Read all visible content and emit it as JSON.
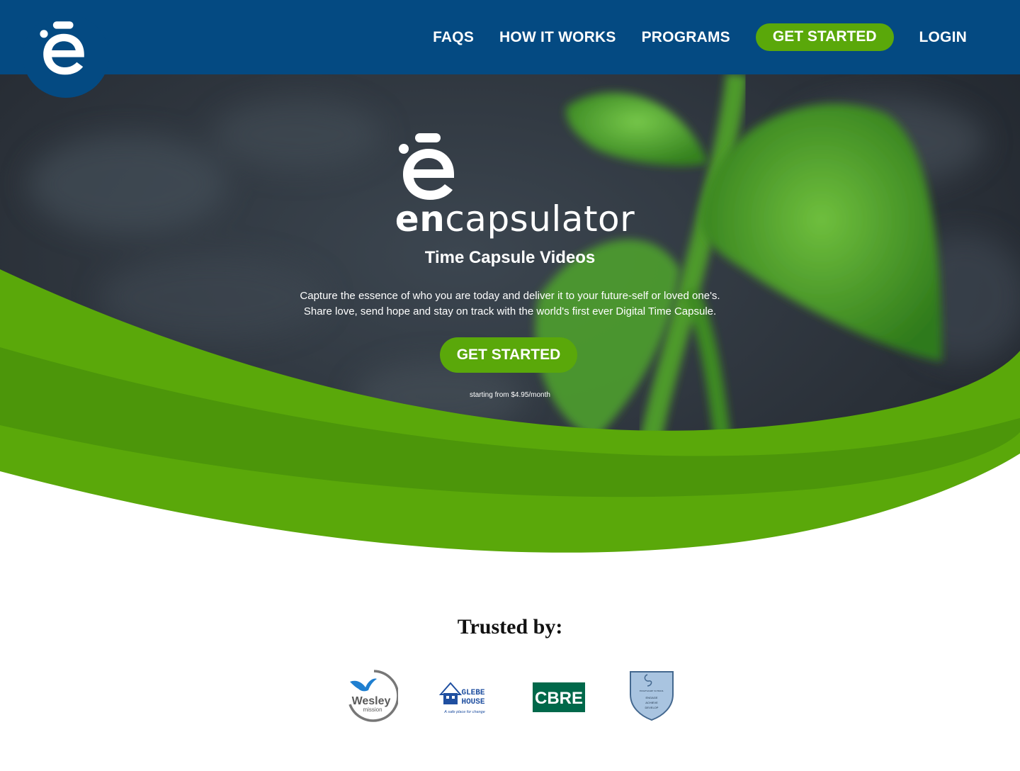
{
  "header": {
    "nav": [
      {
        "label": "FAQS"
      },
      {
        "label": "HOW IT WORKS"
      },
      {
        "label": "PROGRAMS"
      }
    ],
    "cta_label": "GET STARTED",
    "login_label": "LOGIN"
  },
  "hero": {
    "wordmark_bold": "en",
    "wordmark_light": "capsulator",
    "tagline": "Time Capsule Videos",
    "text_line1": "Capture the essence of who you are today and deliver it to your future-self or loved one's.",
    "text_line2": "Share love, send hope and stay on track with the world's first ever Digital Time Capsule.",
    "cta_label": "GET STARTED",
    "price_note": "starting from $4.95/month"
  },
  "trusted": {
    "title": "Trusted by:",
    "logos": [
      {
        "name": "Wesley",
        "sub": "mission"
      },
      {
        "name": "GLEBE HOUSE",
        "sub": "A safe place for change"
      },
      {
        "name": "CBRE"
      },
      {
        "name": "EDGEWARE SCHOOL",
        "sub1": "ENGAGE",
        "sub2": "ACHIEVE",
        "sub3": "DEVELOP"
      }
    ]
  },
  "colors": {
    "navy": "#044a82",
    "green": "#5aa80a",
    "dark_green": "#3f8a05",
    "cbre_green": "#00684a"
  },
  "icons": [
    "encapsulator-logo-icon"
  ]
}
